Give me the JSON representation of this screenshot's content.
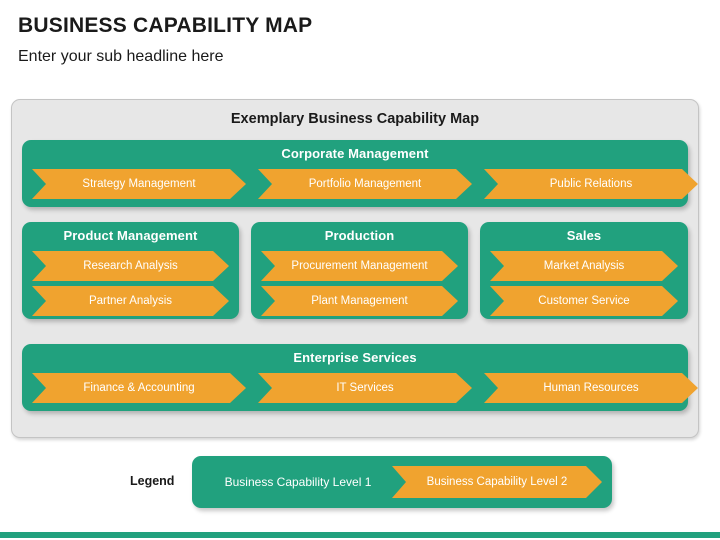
{
  "slide": {
    "title": "BUSINESS CAPABILITY MAP",
    "subtitle": "Enter your sub headline here"
  },
  "panel": {
    "title": "Exemplary Business Capability Map"
  },
  "colors": {
    "green": "#21A17E",
    "orange": "#F0A32F",
    "panel_background": "#E7E7E7",
    "panel_border": "#C4C4C4",
    "text_light": "#FFFFFF",
    "text_dark": "#1A1A1A"
  },
  "groups": {
    "corporate_management": {
      "title": "Corporate Management",
      "capabilities": [
        "Strategy Management",
        "Portfolio Management",
        "Public Relations"
      ]
    },
    "product_management": {
      "title": "Product Management",
      "capabilities": [
        "Research Analysis",
        "Partner Analysis"
      ]
    },
    "production": {
      "title": "Production",
      "capabilities": [
        "Procurement Management",
        "Plant Management"
      ]
    },
    "sales": {
      "title": "Sales",
      "capabilities": [
        "Market Analysis",
        "Customer Service"
      ]
    },
    "enterprise_services": {
      "title": "Enterprise Services",
      "capabilities": [
        "Finance & Accounting",
        "IT Services",
        "Human Resources"
      ]
    }
  },
  "legend": {
    "label": "Legend",
    "level1": "Business Capability Level 1",
    "level2": "Business Capability Level 2"
  }
}
